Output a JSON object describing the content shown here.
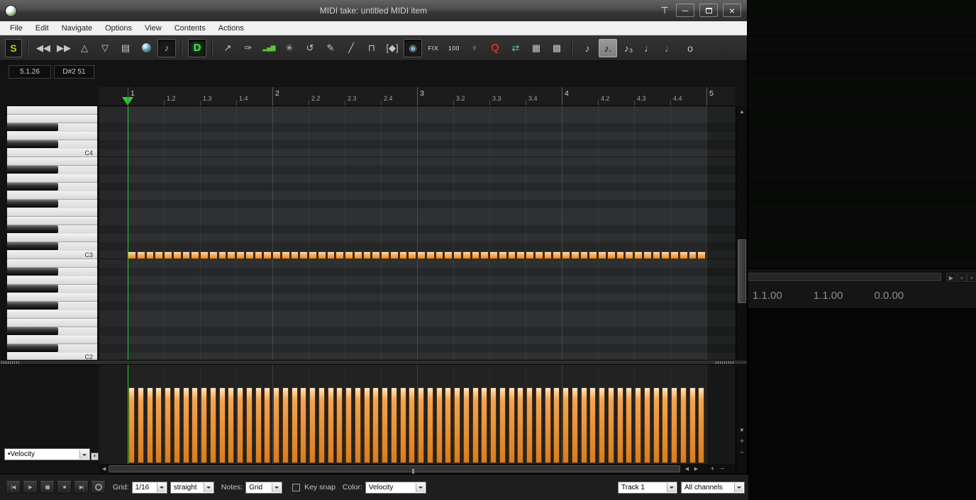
{
  "titlebar": {
    "title": "MIDI take: untitled MIDI item",
    "controls": [
      "pin",
      "minimize",
      "maximize",
      "close"
    ]
  },
  "menubar": {
    "items": [
      "File",
      "Edit",
      "Navigate",
      "Options",
      "View",
      "Contents",
      "Actions"
    ]
  },
  "toolbar": {
    "items": [
      {
        "name": "source-button",
        "label": "S",
        "kind": "text-yellow"
      },
      {
        "name": "separator"
      },
      {
        "name": "prev-measure-button",
        "icon": "double-left-arrow-icon"
      },
      {
        "name": "next-measure-button",
        "icon": "double-right-arrow-icon"
      },
      {
        "name": "octave-up-button",
        "icon": "triangle-up-icon"
      },
      {
        "name": "octave-down-button",
        "icon": "triangle-down-icon"
      },
      {
        "name": "event-list-button",
        "icon": "list-icon"
      },
      {
        "name": "channel-color-button",
        "icon": "sphere-icon"
      },
      {
        "name": "preview-notes-button",
        "icon": "note-arrow-icon",
        "pressed": true
      },
      {
        "name": "separator"
      },
      {
        "name": "dock-button",
        "label": "D",
        "kind": "text-green",
        "pressed": true
      },
      {
        "name": "separator"
      },
      {
        "name": "insert-note-button",
        "icon": "arrow-plus-icon"
      },
      {
        "name": "edit-lock-button",
        "icon": "lock-pencil-icon"
      },
      {
        "name": "cc-lanes-button",
        "icon": "green-bars-icon"
      },
      {
        "name": "split-notes-button",
        "icon": "star-nodes-icon"
      },
      {
        "name": "lasso-button",
        "icon": "circle-arrow-icon"
      },
      {
        "name": "draw-tool-button",
        "icon": "pencil-icon"
      },
      {
        "name": "line-tool-button",
        "icon": "line-icon"
      },
      {
        "name": "step-input-button",
        "icon": "step-icon"
      },
      {
        "name": "marquee-tool-button",
        "icon": "bracket-diamond-icon"
      },
      {
        "name": "compact-mode-button",
        "icon": "circle-icon",
        "pressed": true
      },
      {
        "name": "fix-length-button",
        "label": "FIX",
        "kind": "text-small"
      },
      {
        "name": "default-velocity-button",
        "label": "100",
        "kind": "text-small"
      },
      {
        "name": "note-listen-button",
        "icon": "green-fork-icon"
      },
      {
        "name": "quantize-button",
        "label": "Q",
        "kind": "text-red"
      },
      {
        "name": "swap-channels-button",
        "icon": "swap-arrows-icon"
      },
      {
        "name": "grid-settings-button",
        "icon": "grid-icon"
      },
      {
        "name": "grid-extend-button",
        "icon": "grid-arrows-icon"
      },
      {
        "name": "separator"
      },
      {
        "name": "note-eighth-button",
        "icon": "eighth-note-icon"
      },
      {
        "name": "note-dotted-eighth-button",
        "icon": "dotted-eighth-note-icon",
        "active": true
      },
      {
        "name": "note-triplet-button",
        "icon": "triplet-note-icon"
      },
      {
        "name": "note-quarter-button",
        "icon": "quarter-note-icon"
      },
      {
        "name": "note-half-button",
        "icon": "half-note-icon"
      },
      {
        "name": "note-whole-button",
        "icon": "whole-note-icon"
      }
    ]
  },
  "position_display": {
    "time": "5.1.26",
    "pitch": "D#2 51"
  },
  "ruler": {
    "labels": [
      "1",
      "1.2",
      "1.3",
      "1.4",
      "2",
      "2.2",
      "2.3",
      "2.4",
      "3",
      "3.2",
      "3.3",
      "3.4",
      "4",
      "4.2",
      "4.3",
      "4.4",
      "5"
    ]
  },
  "grid": {
    "measures": 4,
    "beats_per_measure": 4,
    "division_label": "1/16"
  },
  "piano": {
    "visible_top_note": "F4",
    "visible_bottom_note": "C2",
    "rows": 30,
    "labels": [
      "C4",
      "C3",
      "C2"
    ]
  },
  "notes": {
    "pitch": "C3",
    "count": 64,
    "velocity": 100
  },
  "velocity_lane": {
    "selector_value": "•Velocity",
    "add_lane_label": "+"
  },
  "bottom_bar": {
    "transport": [
      {
        "name": "go-to-start-button",
        "icon": "skip-to-start-icon"
      },
      {
        "name": "play-button",
        "icon": "play-icon"
      },
      {
        "name": "pause-button",
        "icon": "pause-icon"
      },
      {
        "name": "stop-button",
        "icon": "stop-icon"
      },
      {
        "name": "go-to-end-button",
        "icon": "skip-to-end-icon"
      },
      {
        "name": "repeat-button",
        "icon": "loop-icon"
      }
    ],
    "grid_label": "Grid:",
    "grid_division": "1/16",
    "grid_swing": "straight",
    "notes_label": "Notes:",
    "notes_division": "Grid",
    "key_snap_label": "Key snap",
    "key_snap_checked": false,
    "color_label": "Color:",
    "color_mode": "Velocity",
    "track_selector": "Track 1",
    "channel_selector": "All channels"
  },
  "background": {
    "position_values": [
      "1.1.00",
      "1.1.00",
      "0.0.00"
    ]
  },
  "colors": {
    "note_fill": "#f59b3c",
    "note_border": "#4d2c00",
    "velocity_bar": "#d97c1e",
    "play_cursor": "#2ecc2e",
    "menubar_bg": "#f1f1f1"
  }
}
